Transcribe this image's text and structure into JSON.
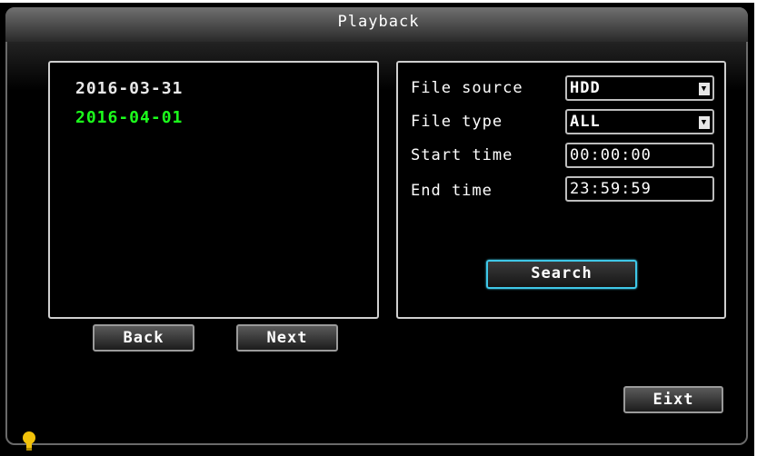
{
  "window": {
    "title": "Playback"
  },
  "date_list": {
    "items": [
      {
        "label": "2016-03-31",
        "selected": false
      },
      {
        "label": "2016-04-01",
        "selected": true
      }
    ]
  },
  "filters": {
    "file_source": {
      "label": "File source",
      "value": "HDD"
    },
    "file_type": {
      "label": "File type",
      "value": "ALL"
    },
    "start_time": {
      "label": "Start time",
      "value": "00:00:00"
    },
    "end_time": {
      "label": "End time",
      "value": "23:59:59"
    }
  },
  "buttons": {
    "search": "Search",
    "back": "Back",
    "next": "Next",
    "exit": "Eixt"
  },
  "colors": {
    "selected_date": "#1cff1c",
    "focus_border": "#3fc8e8",
    "status_icon": "#f2c20a"
  },
  "status_bar": {
    "icon": "lightbulb-icon"
  }
}
